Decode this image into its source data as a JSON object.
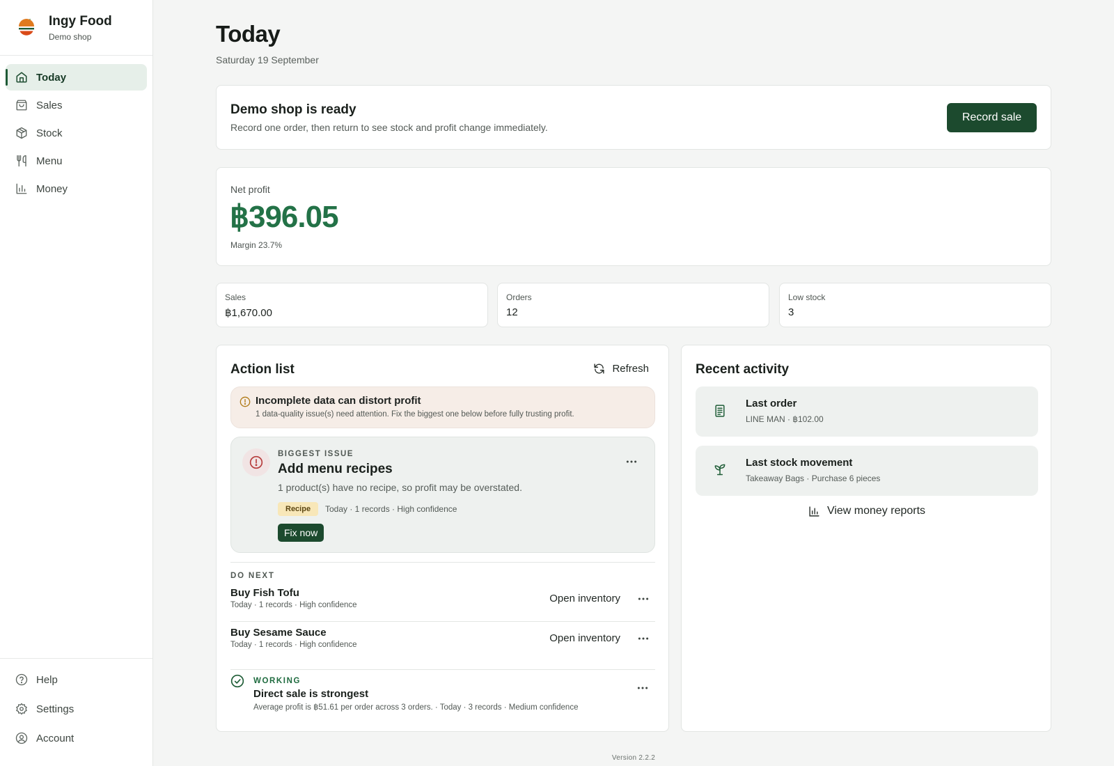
{
  "brand": {
    "name": "Ingy Food",
    "subtitle": "Demo shop"
  },
  "nav": {
    "items": [
      {
        "label": "Today",
        "icon": "home-icon",
        "active": true
      },
      {
        "label": "Sales",
        "icon": "bag-icon"
      },
      {
        "label": "Stock",
        "icon": "box-icon"
      },
      {
        "label": "Menu",
        "icon": "utensils-icon"
      },
      {
        "label": "Money",
        "icon": "bar-chart-icon"
      }
    ],
    "bottom": [
      {
        "label": "Help",
        "icon": "help-icon"
      },
      {
        "label": "Settings",
        "icon": "gear-icon"
      },
      {
        "label": "Account",
        "icon": "user-icon"
      }
    ]
  },
  "page": {
    "title": "Today",
    "date": "Saturday 19 September"
  },
  "ready": {
    "title": "Demo shop is ready",
    "text": "Record one order, then return to see stock and profit change immediately.",
    "button": "Record sale"
  },
  "profit": {
    "label": "Net profit",
    "value": "฿396.05",
    "margin": "Margin 23.7%",
    "color": "#237247"
  },
  "stats": [
    {
      "label": "Sales",
      "value": "฿1,670.00"
    },
    {
      "label": "Orders",
      "value": "12"
    },
    {
      "label": "Low stock",
      "value": "3"
    }
  ],
  "actions": {
    "title": "Action list",
    "refresh": "Refresh",
    "warning": {
      "title": "Incomplete data can distort profit",
      "text": "1 data-quality issue(s) need attention. Fix the biggest one below before fully trusting profit."
    },
    "issue": {
      "kicker": "BIGGEST ISSUE",
      "title": "Add menu recipes",
      "text": "1 product(s) have no recipe, so profit may be overstated.",
      "tag": "Recipe",
      "meta": "Today · 1 records · High confidence",
      "button": "Fix now"
    },
    "do_next_label": "DO NEXT",
    "tasks": [
      {
        "title": "Buy Fish Tofu",
        "meta": "Today · 1 records · High confidence",
        "link": "Open inventory"
      },
      {
        "title": "Buy Sesame Sauce",
        "meta": "Today · 1 records · High confidence",
        "link": "Open inventory"
      }
    ],
    "working": {
      "kicker": "WORKING",
      "title": "Direct sale is strongest",
      "meta": "Average profit is ฿51.61 per order across 3 orders. · Today · 3 records · Medium confidence"
    }
  },
  "activity": {
    "title": "Recent activity",
    "items": [
      {
        "title": "Last order",
        "meta": "LINE MAN · ฿102.00",
        "icon": "receipt-icon"
      },
      {
        "title": "Last stock movement",
        "meta": "Takeaway Bags · Purchase 6 pieces",
        "icon": "sprout-icon"
      }
    ],
    "reports_link": "View money reports"
  },
  "version": "Version 2.2.2",
  "colors": {
    "accent": "#1c4a2e",
    "warning_bg": "#f6ede7",
    "tag_bg": "#f8e7b8",
    "danger": "#b63c3c"
  }
}
